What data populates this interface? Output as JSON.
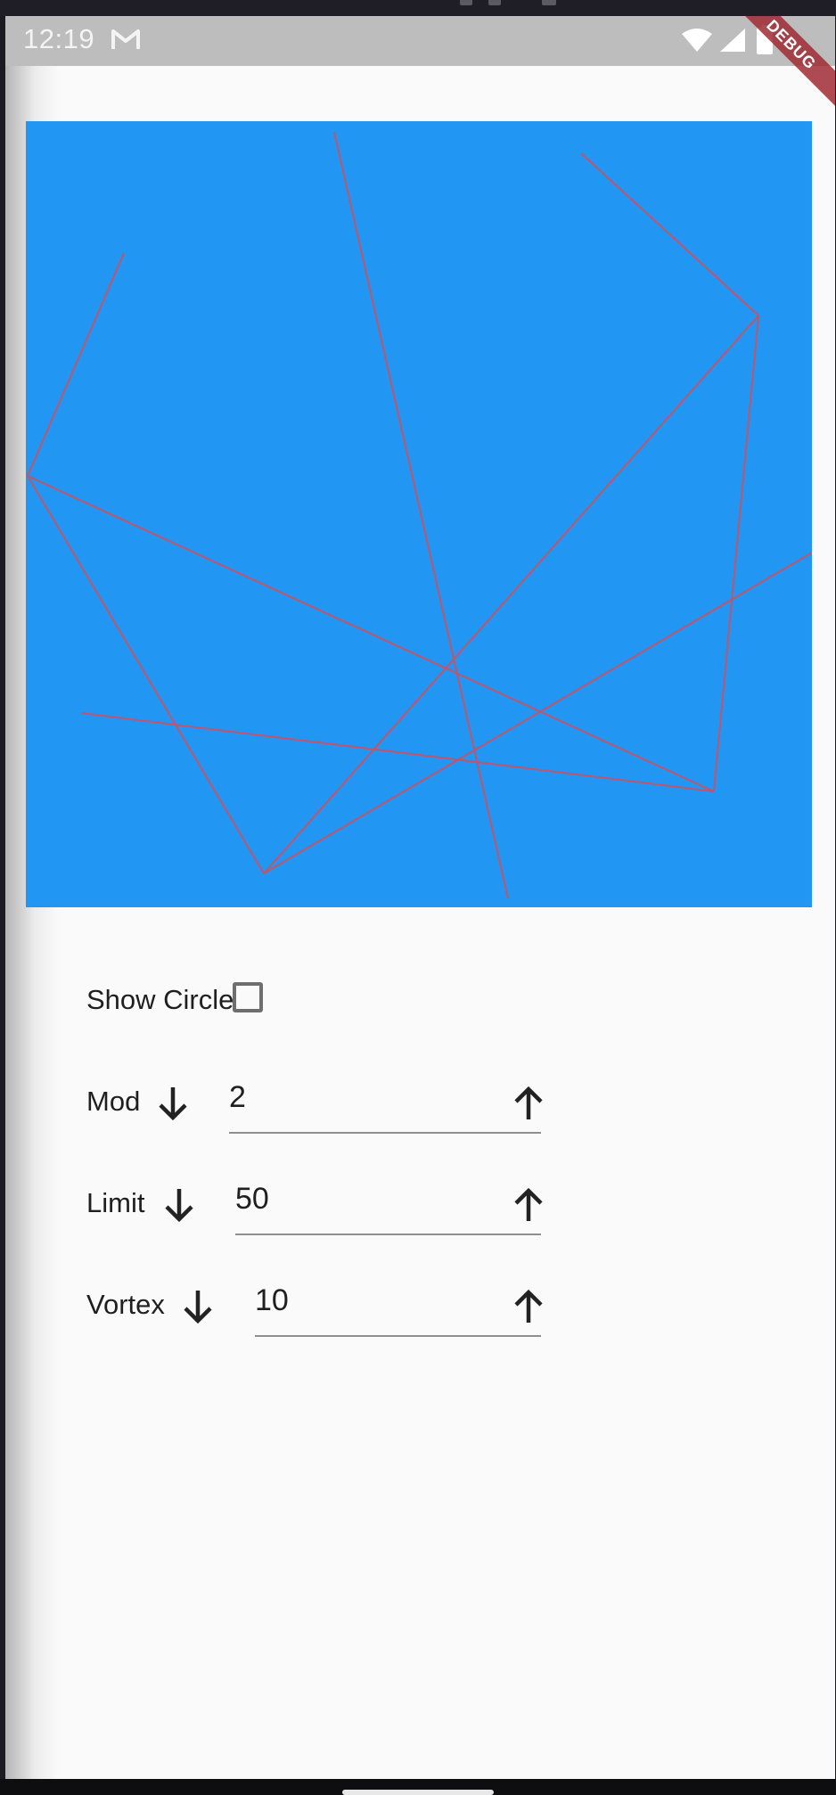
{
  "status_bar": {
    "time": "12:19",
    "icons": [
      "gmail-icon",
      "wifi-icon",
      "signal-icon",
      "battery-icon"
    ],
    "background": "#bdbdbd"
  },
  "debug_banner": {
    "label": "DEBUG",
    "color": "#a02c34"
  },
  "canvas": {
    "background": "#2196f3",
    "line_color": "#c0566b"
  },
  "controls": {
    "show_circle": {
      "label": "Show Circle",
      "checked": false
    },
    "mod": {
      "label": "Mod",
      "value": "2",
      "down_icon": "arrow-down-icon",
      "up_icon": "arrow-up-icon"
    },
    "limit": {
      "label": "Limit",
      "value": "50",
      "down_icon": "arrow-down-icon",
      "up_icon": "arrow-up-icon"
    },
    "vortex": {
      "label": "Vortex",
      "value": "10",
      "down_icon": "arrow-down-icon",
      "up_icon": "arrow-up-icon"
    }
  }
}
